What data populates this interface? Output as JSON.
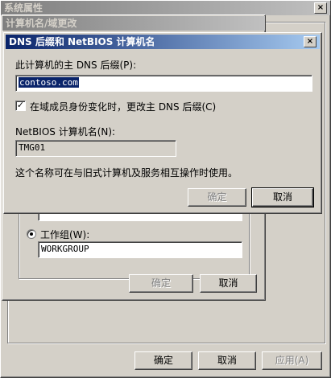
{
  "sysprops": {
    "title": "系统属性",
    "close_glyph": "×",
    "buttons": {
      "ok": "确定",
      "cancel": "取消",
      "apply": "应用(A)"
    }
  },
  "computer_name_changes": {
    "title": "计算机名/域更改",
    "workgroup_label": "工作组(W):",
    "workgroup_value": "WORKGROUP",
    "buttons": {
      "ok": "确定",
      "cancel": "取消"
    }
  },
  "dns_dialog": {
    "title": "DNS 后缀和 NetBIOS 计算机名",
    "close_glyph": "×",
    "primary_dns_label": "此计算机的主 DNS 后缀(P):",
    "primary_dns_value": "contoso.com",
    "checkbox_label": "在域成员身份变化时，更改主 DNS 后缀(C)",
    "checkbox_checked": true,
    "checkbox_glyph": "✓",
    "netbios_label": "NetBIOS 计算机名(N):",
    "netbios_value": "TMG01",
    "info_text": "这个名称可在与旧式计算机及服务相互操作时使用。",
    "buttons": {
      "ok": "确定",
      "cancel": "取消"
    }
  }
}
